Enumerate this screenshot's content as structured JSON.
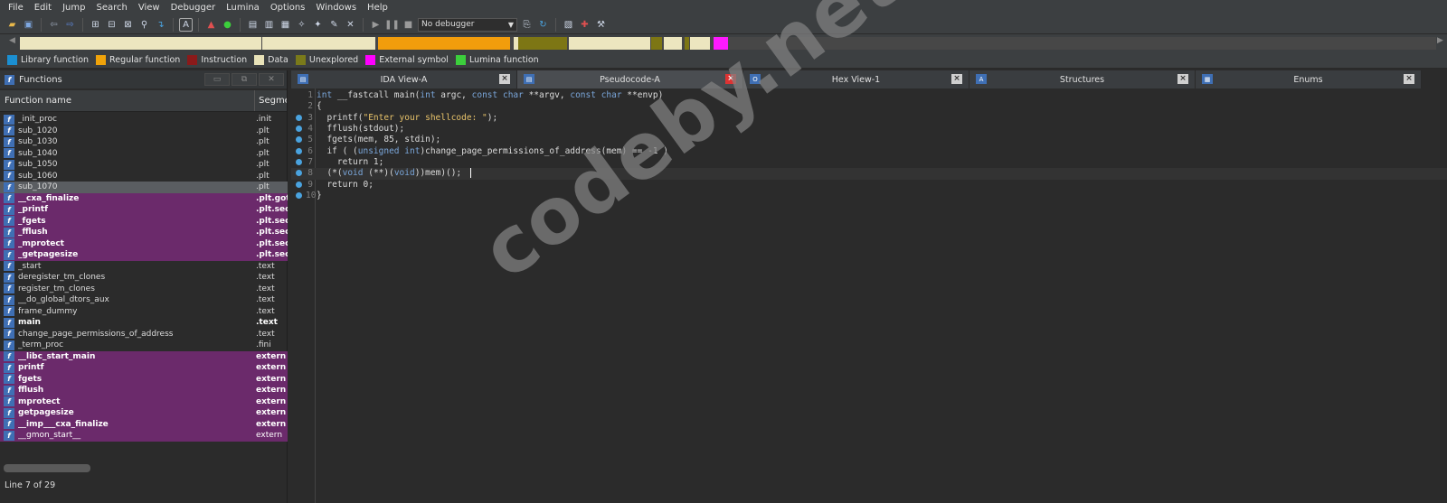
{
  "menu": [
    "File",
    "Edit",
    "Jump",
    "Search",
    "View",
    "Debugger",
    "Lumina",
    "Options",
    "Windows",
    "Help"
  ],
  "toolbar": {
    "debugger_select": "No debugger"
  },
  "legend": [
    {
      "label": "Library function",
      "color": "#1b8fd1"
    },
    {
      "label": "Regular function",
      "color": "#f0a30a"
    },
    {
      "label": "Instruction",
      "color": "#8b1a1a"
    },
    {
      "label": "Data",
      "color": "#e8e2b8"
    },
    {
      "label": "Unexplored",
      "color": "#7a7a1a"
    },
    {
      "label": "External symbol",
      "color": "#ff00ff"
    },
    {
      "label": "Lumina function",
      "color": "#3ccf3c"
    }
  ],
  "functions_pane": {
    "title": "Functions",
    "col_name": "Function name",
    "col_segment": "Segme",
    "status": "Line 7 of 29",
    "rows": [
      {
        "name": "_init_proc",
        "segment": ".init",
        "style": ""
      },
      {
        "name": "sub_1020",
        "segment": ".plt",
        "style": ""
      },
      {
        "name": "sub_1030",
        "segment": ".plt",
        "style": ""
      },
      {
        "name": "sub_1040",
        "segment": ".plt",
        "style": ""
      },
      {
        "name": "sub_1050",
        "segment": ".plt",
        "style": ""
      },
      {
        "name": "sub_1060",
        "segment": ".plt",
        "style": ""
      },
      {
        "name": "sub_1070",
        "segment": ".plt",
        "style": "sel"
      },
      {
        "name": "__cxa_finalize",
        "segment": ".plt.got",
        "style": "ext"
      },
      {
        "name": "_printf",
        "segment": ".plt.sec",
        "style": "ext"
      },
      {
        "name": "_fgets",
        "segment": ".plt.sec",
        "style": "ext"
      },
      {
        "name": "_fflush",
        "segment": ".plt.sec",
        "style": "ext"
      },
      {
        "name": "_mprotect",
        "segment": ".plt.sec",
        "style": "ext"
      },
      {
        "name": "_getpagesize",
        "segment": ".plt.sec",
        "style": "ext"
      },
      {
        "name": "_start",
        "segment": ".text",
        "style": ""
      },
      {
        "name": "deregister_tm_clones",
        "segment": ".text",
        "style": ""
      },
      {
        "name": "register_tm_clones",
        "segment": ".text",
        "style": ""
      },
      {
        "name": "__do_global_dtors_aux",
        "segment": ".text",
        "style": ""
      },
      {
        "name": "frame_dummy",
        "segment": ".text",
        "style": ""
      },
      {
        "name": "main",
        "segment": ".text",
        "style": "bold"
      },
      {
        "name": "change_page_permissions_of_address",
        "segment": ".text",
        "style": ""
      },
      {
        "name": "_term_proc",
        "segment": ".fini",
        "style": ""
      },
      {
        "name": "__libc_start_main",
        "segment": "extern",
        "style": "ext"
      },
      {
        "name": "printf",
        "segment": "extern",
        "style": "ext"
      },
      {
        "name": "fgets",
        "segment": "extern",
        "style": "ext"
      },
      {
        "name": "fflush",
        "segment": "extern",
        "style": "ext"
      },
      {
        "name": "mprotect",
        "segment": "extern",
        "style": "ext"
      },
      {
        "name": "getpagesize",
        "segment": "extern",
        "style": "ext"
      },
      {
        "name": "__imp___cxa_finalize",
        "segment": "extern",
        "style": "ext"
      },
      {
        "name": "__gmon_start__",
        "segment": "extern",
        "style": "ext-plain"
      }
    ]
  },
  "tabs": [
    {
      "label": "IDA View-A",
      "active": false
    },
    {
      "label": "Pseudocode-A",
      "active": true
    },
    {
      "label": "Hex View-1",
      "active": false
    },
    {
      "label": "Structures",
      "active": false
    },
    {
      "label": "Enums",
      "active": false
    }
  ],
  "code": {
    "current_line": 8,
    "lines": [
      {
        "num": "1",
        "dot": false,
        "text": "int __fastcall main(int argc, const char **argv, const char **envp)"
      },
      {
        "num": "2",
        "dot": false,
        "text": "{"
      },
      {
        "num": "3",
        "dot": true,
        "text": "  printf(\"Enter your shellcode: \");"
      },
      {
        "num": "4",
        "dot": true,
        "text": "  fflush(stdout);"
      },
      {
        "num": "5",
        "dot": true,
        "text": "  fgets(mem, 85, stdin);"
      },
      {
        "num": "6",
        "dot": true,
        "text": "  if ( (unsigned int)change_page_permissions_of_address(mem) == -1 )"
      },
      {
        "num": "7",
        "dot": true,
        "text": "    return 1;"
      },
      {
        "num": "8",
        "dot": true,
        "text": "  (*(void (**)(void))mem)();"
      },
      {
        "num": "9",
        "dot": true,
        "text": "  return 0;"
      },
      {
        "num": "10",
        "dot": true,
        "text": "}"
      }
    ]
  },
  "watermark": "codeby.net"
}
